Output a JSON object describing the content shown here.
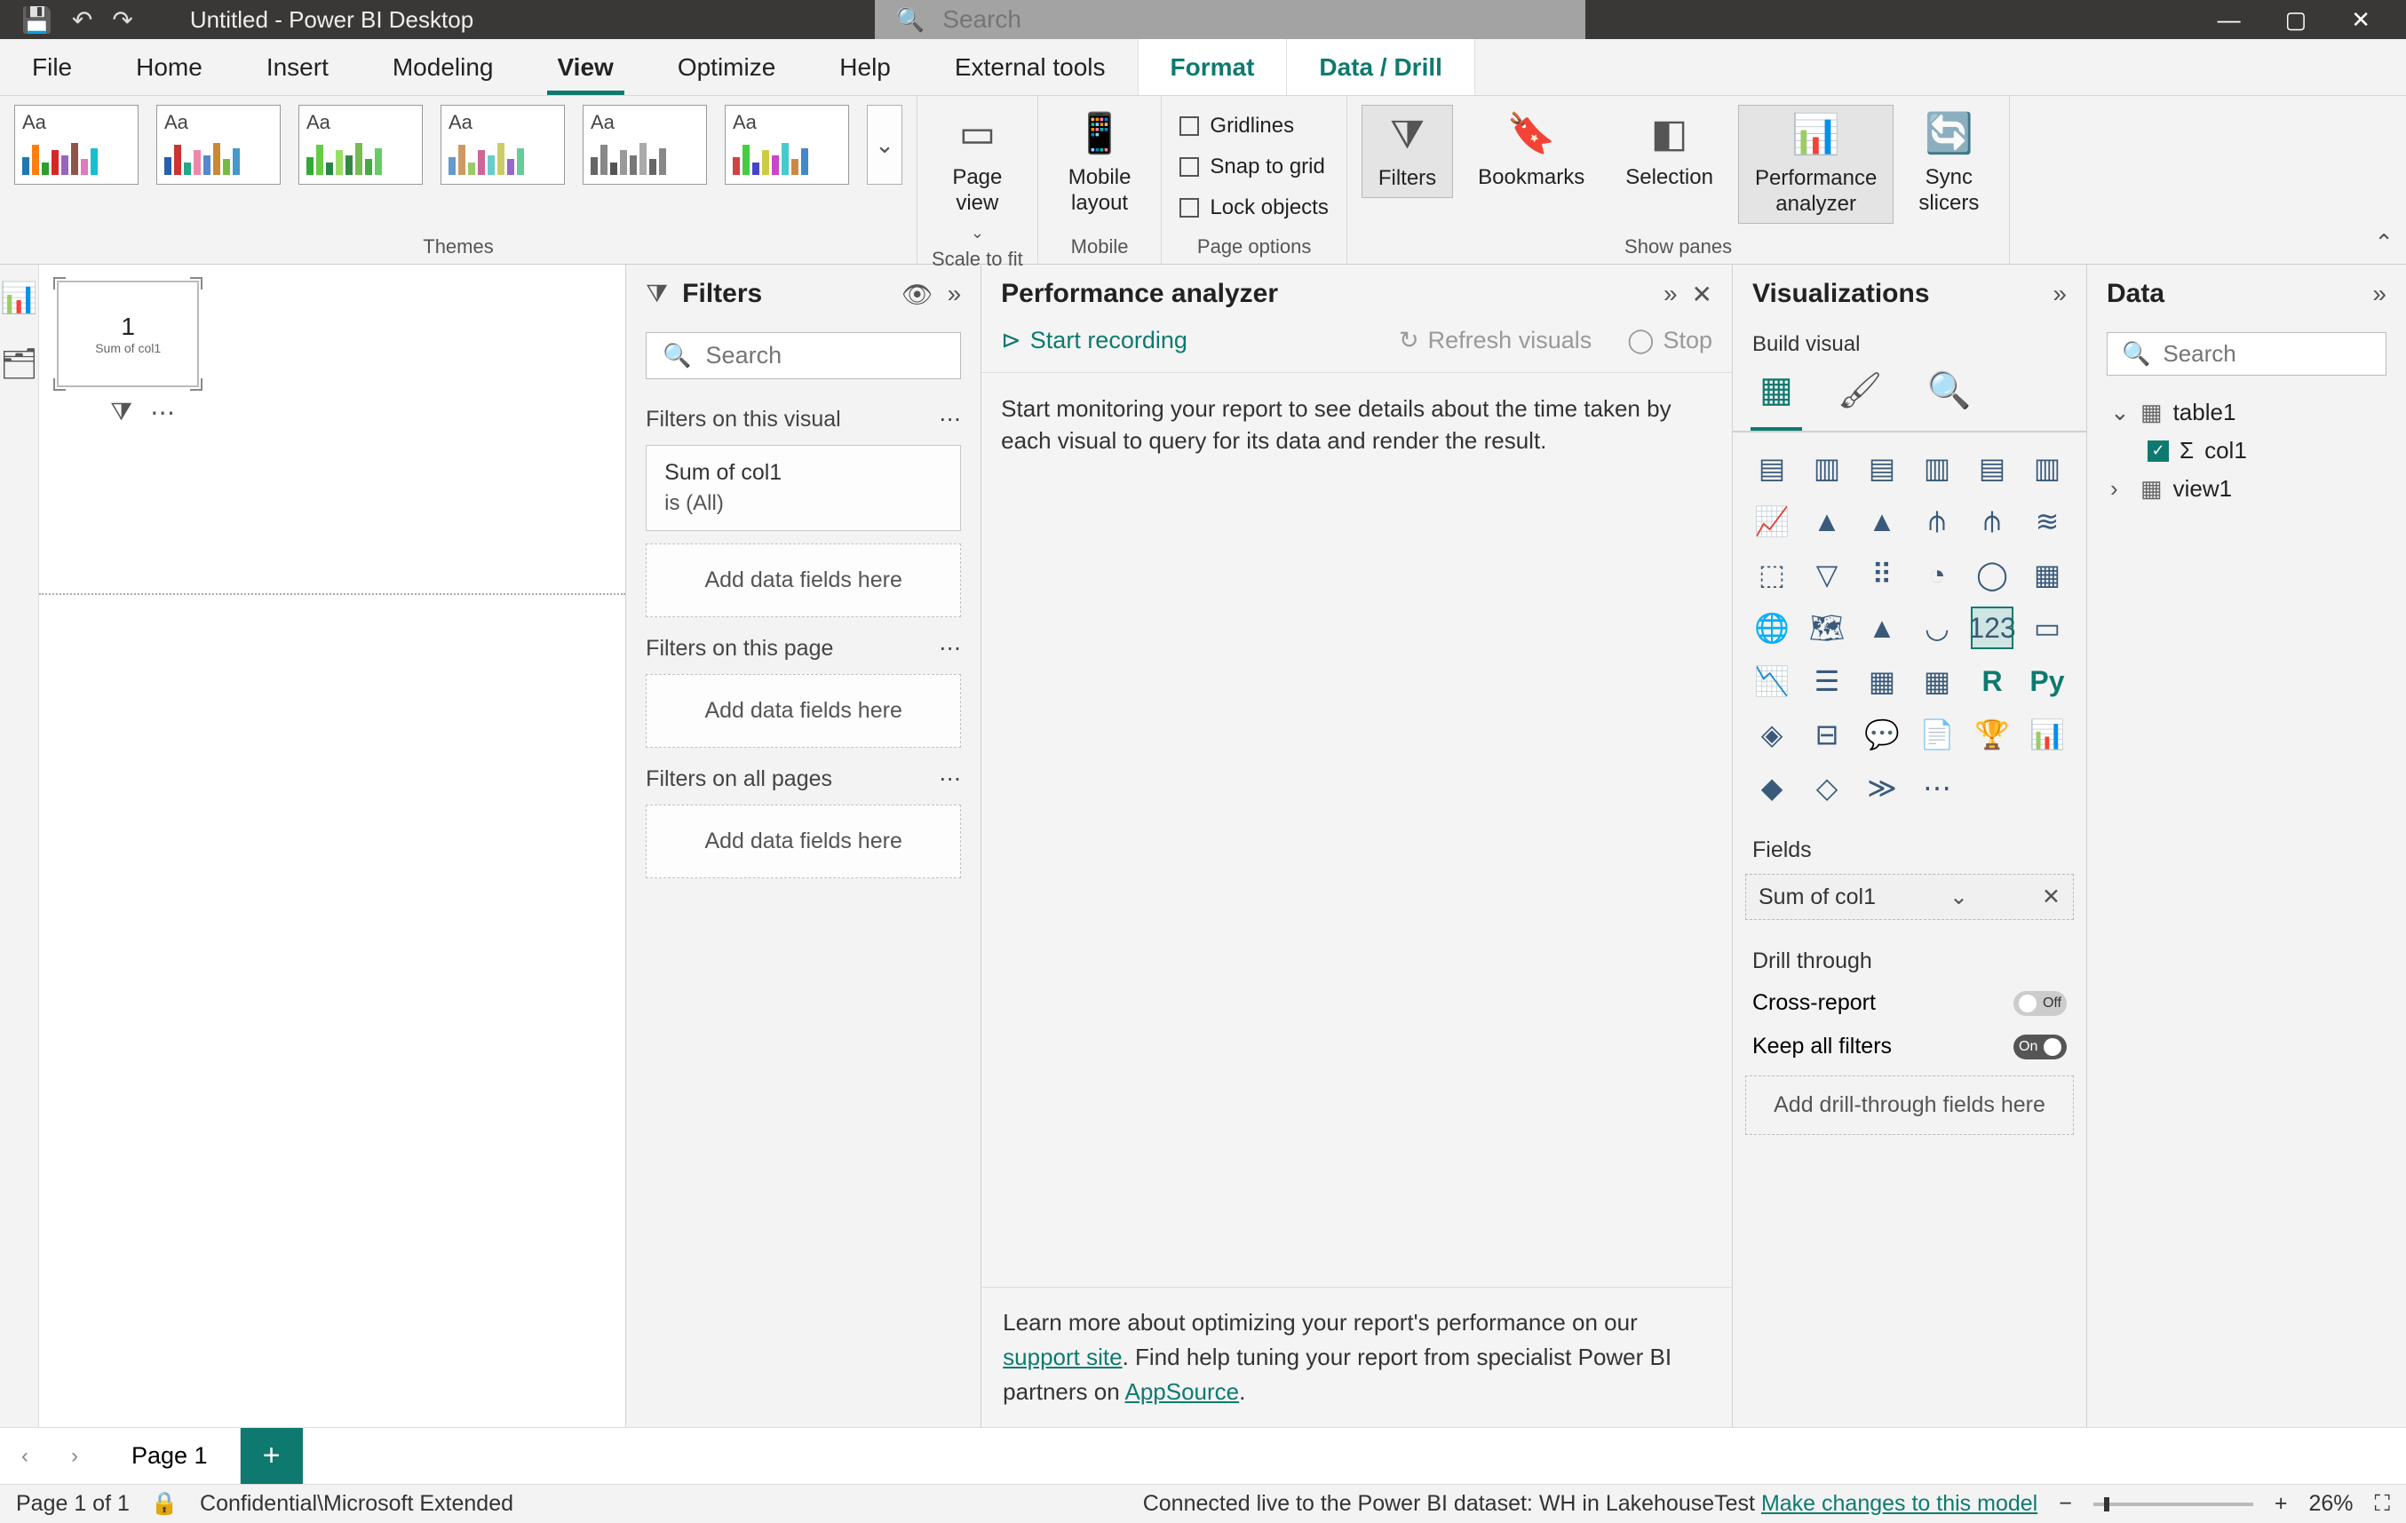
{
  "titlebar": {
    "doc_name": "Untitled - Power BI Desktop",
    "search_placeholder": "Search"
  },
  "ribbon_tabs": {
    "file": "File",
    "home": "Home",
    "insert": "Insert",
    "modeling": "Modeling",
    "view": "View",
    "optimize": "Optimize",
    "help": "Help",
    "external": "External tools",
    "format": "Format",
    "data_drill": "Data / Drill"
  },
  "ribbon": {
    "groups": {
      "themes": "Themes",
      "scale": "Scale to fit",
      "mobile": "Mobile",
      "page_options": "Page options",
      "show_panes": "Show panes"
    },
    "scale": {
      "page_view": "Page\nview"
    },
    "mobile": {
      "layout": "Mobile\nlayout"
    },
    "page_options": {
      "gridlines": "Gridlines",
      "snap": "Snap to grid",
      "lock": "Lock objects"
    },
    "show_panes": {
      "filters": "Filters",
      "bookmarks": "Bookmarks",
      "selection": "Selection",
      "perf": "Performance\nanalyzer",
      "sync": "Sync\nslicers"
    }
  },
  "canvas": {
    "visual_value": "1",
    "visual_caption": "Sum of col1"
  },
  "filters": {
    "title": "Filters",
    "search_placeholder": "Search",
    "section_visual": "Filters on this visual",
    "section_page": "Filters on this page",
    "section_all": "Filters on all pages",
    "card_field": "Sum of col1",
    "card_summary": "is (All)",
    "drop_text": "Add data fields here"
  },
  "perf": {
    "title": "Performance analyzer",
    "start": "Start recording",
    "refresh": "Refresh visuals",
    "stop": "Stop",
    "body": "Start monitoring your report to see details about the time taken by each visual to query for its data and render the result.",
    "footer1": "Learn more about optimizing your report's performance on our ",
    "footer_link1": "support site",
    "footer2": ". Find help tuning your report from specialist Power BI partners on ",
    "footer_link2": "AppSource"
  },
  "viz": {
    "title": "Visualizations",
    "build": "Build visual",
    "fields_title": "Fields",
    "field_value": "Sum of col1",
    "drill_title": "Drill through",
    "cross_report": "Cross-report",
    "keep_filters": "Keep all filters",
    "off": "Off",
    "on": "On",
    "drill_drop": "Add drill-through fields here"
  },
  "data": {
    "title": "Data",
    "search_placeholder": "Search",
    "table": "table1",
    "col": "col1",
    "view": "view1"
  },
  "page_tabs": {
    "page1": "Page 1"
  },
  "status": {
    "page": "Page 1 of 1",
    "classification": "Confidential\\Microsoft Extended",
    "connection": "Connected live to the Power BI dataset: WH in LakehouseTest ",
    "changes_link": "Make changes to this model",
    "zoom_pct": "26%"
  }
}
